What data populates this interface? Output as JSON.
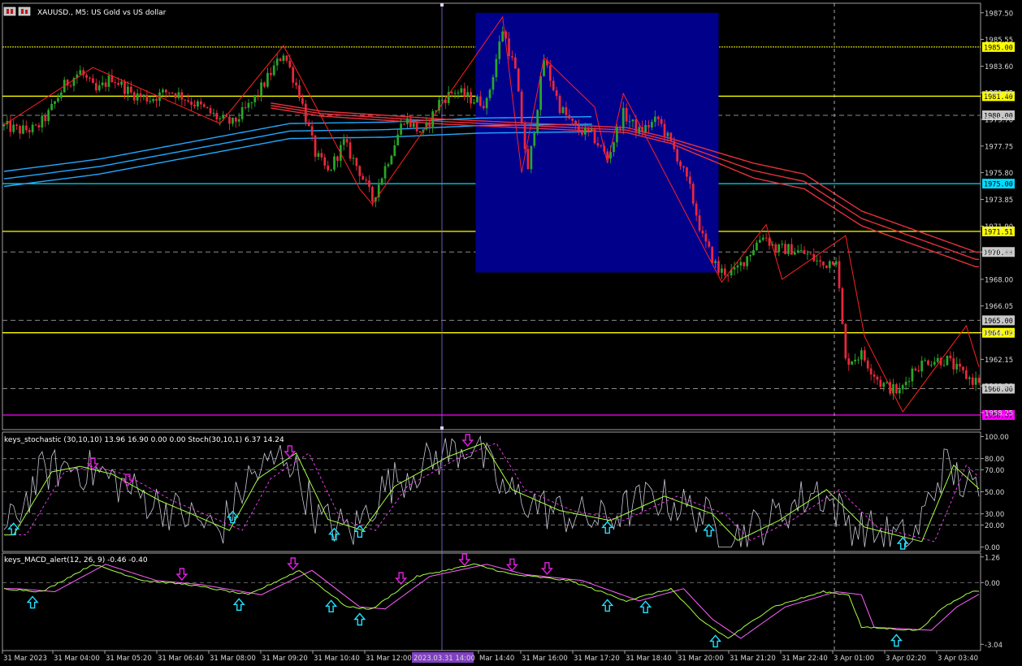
{
  "window": {
    "title": "XAUUSD., M5:  US Gold vs US dollar",
    "icon": "chart-window-icon"
  },
  "colors": {
    "background": "#000000",
    "frame": "#c8c8c8",
    "bull": "#2aa52a",
    "bear": "#e8283c",
    "yellow": "#ffff00",
    "cyan": "#00dcff",
    "magenta": "#ff00ff",
    "dash": "#8a8a8a",
    "rect": "#00008b",
    "ma_red": "#e8303c",
    "ma_blue": "#22a8ff",
    "zigzag": "#ff2020",
    "stoch_main": "#c8c8d8",
    "stoch_signal": "#a8ff40",
    "stoch_dash": "#ff40ff",
    "macd_main": "#a8ff40",
    "macd_signal": "#ff60ff",
    "arrow_up": "#20e0ff",
    "arrow_down": "#e020e0",
    "time_label_bg": "#8040c0"
  },
  "main_panel": {
    "price_axis": [
      "1987.50",
      "1985.55",
      "1983.60",
      "1981.65",
      "1979.70",
      "1977.75",
      "1975.80",
      "1973.85",
      "1971.90",
      "1970.00",
      "1968.00",
      "1966.05",
      "1964.10",
      "1962.15",
      "1960.20",
      "1958.25"
    ],
    "ylim": [
      1957.0,
      1988.2
    ],
    "levels": [
      {
        "price": 1985.0,
        "label": "1985.00",
        "style": "dotted",
        "color": "#ffff00"
      },
      {
        "price": 1981.4,
        "label": "1981.40",
        "style": "solid",
        "color": "#ffff00"
      },
      {
        "price": 1980.0,
        "label": "1980.00",
        "style": "dash",
        "color": "#8a8a8a"
      },
      {
        "price": 1975.0,
        "label": "1975.00",
        "style": "solid",
        "color": "#00dcff"
      },
      {
        "price": 1971.51,
        "label": "1971.51",
        "style": "solid",
        "color": "#ffff00"
      },
      {
        "price": 1970.0,
        "label": "1970.00",
        "style": "dash",
        "color": "#8a8a8a"
      },
      {
        "price": 1965.0,
        "label": "1965.00",
        "style": "dash",
        "color": "#8a8a8a"
      },
      {
        "price": 1964.09,
        "label": "1964.09",
        "style": "solid",
        "color": "#ffff00"
      },
      {
        "price": 1960.0,
        "label": "1960.00",
        "style": "dash",
        "color": "#8a8a8a"
      },
      {
        "price": 1958.07,
        "label": "1958.07",
        "style": "solid",
        "color": "#ff00ff"
      }
    ],
    "zone": {
      "from_time": "31 Mar 14:00",
      "to_time": "31 Mar 20:40",
      "price_top": 1987.5,
      "price_bottom": 1968.5
    }
  },
  "stoch_panel": {
    "title": "keys_stochastic (30,10,10) 13.96 16.90 0.00 0.00 Stoch(30,10,1) 6.37 14.24",
    "axis": [
      "100.00",
      "80.00",
      "70.00",
      "50.00",
      "30.00",
      "20.00",
      "0.00"
    ],
    "ylim": [
      -4,
      104
    ],
    "levels": [
      80,
      70,
      50,
      30,
      20
    ]
  },
  "macd_panel": {
    "title": "keys_MACD_alert(12, 26, 9) -0.46 -0.40",
    "axis": [
      "1.26",
      "0.00",
      "-3.04"
    ],
    "ylim": [
      -3.35,
      1.45
    ]
  },
  "time_axis": {
    "labels": [
      "31 Mar 2023",
      "31 Mar 04:00",
      "31 Mar 05:20",
      "31 Mar 06:40",
      "31 Mar 08:00",
      "31 Mar 09:20",
      "31 Mar 10:40",
      "31 Mar 12:00",
      "Mar 14:40",
      "31 Mar 16:00",
      "31 Mar 17:20",
      "31 Mar 18:40",
      "31 Mar 20:00",
      "31 Mar 21:20",
      "31 Mar 22:40",
      "3 Apr 01:00",
      "3 Apr 02:20",
      "3 Apr 03:40"
    ],
    "cursor_label": "2023.03.31 14:00"
  },
  "chart_data": {
    "type": "candlestick",
    "title": "XAUUSD., M5:  US Gold vs US dollar",
    "anchors": [
      [
        0,
        1979.2
      ],
      [
        5,
        1978.9
      ],
      [
        10,
        1979.0
      ],
      [
        14,
        1980.1
      ],
      [
        19,
        1982.2
      ],
      [
        24,
        1983.2
      ],
      [
        29,
        1981.7
      ],
      [
        34,
        1982.8
      ],
      [
        40,
        1981.6
      ],
      [
        46,
        1981.2
      ],
      [
        52,
        1981.8
      ],
      [
        56,
        1981.4
      ],
      [
        62,
        1980.6
      ],
      [
        68,
        1979.7
      ],
      [
        72,
        1979.4
      ],
      [
        78,
        1980.9
      ],
      [
        84,
        1983.1
      ],
      [
        88,
        1984.6
      ],
      [
        93,
        1981.6
      ],
      [
        98,
        1977.2
      ],
      [
        102,
        1975.8
      ],
      [
        107,
        1978.0
      ],
      [
        112,
        1975.9
      ],
      [
        116,
        1973.8
      ],
      [
        121,
        1976.8
      ],
      [
        126,
        1979.8
      ],
      [
        132,
        1978.6
      ],
      [
        137,
        1981.0
      ],
      [
        142,
        1981.8
      ],
      [
        147,
        1981.2
      ],
      [
        152,
        1980.9
      ],
      [
        157,
        1986.3
      ],
      [
        161,
        1983.2
      ],
      [
        165,
        1975.8
      ],
      [
        170,
        1984.1
      ],
      [
        175,
        1980.6
      ],
      [
        180,
        1979.0
      ],
      [
        185,
        1978.6
      ],
      [
        190,
        1976.9
      ],
      [
        195,
        1980.1
      ],
      [
        200,
        1978.8
      ],
      [
        206,
        1979.7
      ],
      [
        212,
        1977.0
      ],
      [
        216,
        1974.6
      ],
      [
        220,
        1971.0
      ],
      [
        225,
        1968.6
      ],
      [
        230,
        1968.5
      ],
      [
        234,
        1969.7
      ],
      [
        239,
        1971.3
      ],
      [
        243,
        1970.2
      ],
      [
        248,
        1970.2
      ],
      [
        253,
        1969.8
      ],
      [
        258,
        1969.0
      ],
      [
        262,
        1969.7
      ],
      [
        265,
        1962.0
      ],
      [
        270,
        1962.5
      ],
      [
        276,
        1960.4
      ],
      [
        282,
        1959.7
      ],
      [
        286,
        1961.4
      ],
      [
        291,
        1962.1
      ],
      [
        297,
        1962.1
      ],
      [
        300,
        1961.4
      ],
      [
        305,
        1960.6
      ]
    ],
    "stoch_anchors": [
      [
        0,
        11
      ],
      [
        12,
        68
      ],
      [
        21,
        73
      ],
      [
        31,
        66
      ],
      [
        46,
        42
      ],
      [
        56,
        30
      ],
      [
        68,
        15
      ],
      [
        77,
        62
      ],
      [
        89,
        85
      ],
      [
        99,
        25
      ],
      [
        110,
        15
      ],
      [
        120,
        55
      ],
      [
        137,
        82
      ],
      [
        148,
        94
      ],
      [
        157,
        52
      ],
      [
        172,
        33
      ],
      [
        188,
        24
      ],
      [
        205,
        46
      ],
      [
        220,
        30
      ],
      [
        228,
        6
      ],
      [
        241,
        24
      ],
      [
        256,
        52
      ],
      [
        268,
        18
      ],
      [
        286,
        5
      ],
      [
        296,
        74
      ],
      [
        305,
        50
      ]
    ],
    "macd_anchors": [
      [
        0,
        -0.3
      ],
      [
        12,
        -0.45
      ],
      [
        28,
        0.9
      ],
      [
        44,
        0.1
      ],
      [
        58,
        -0.1
      ],
      [
        77,
        -0.6
      ],
      [
        93,
        0.6
      ],
      [
        108,
        -1.2
      ],
      [
        116,
        -1.3
      ],
      [
        130,
        0.3
      ],
      [
        148,
        0.9
      ],
      [
        160,
        0.4
      ],
      [
        178,
        0.1
      ],
      [
        196,
        -0.9
      ],
      [
        210,
        -0.3
      ],
      [
        219,
        -1.8
      ],
      [
        228,
        -2.75
      ],
      [
        242,
        -1.2
      ],
      [
        258,
        -0.45
      ],
      [
        266,
        -0.6
      ],
      [
        270,
        -2.2
      ],
      [
        288,
        -2.35
      ],
      [
        296,
        -1.2
      ],
      [
        305,
        -0.4
      ]
    ],
    "zigzag_price": [
      [
        0,
        1979.3
      ],
      [
        28,
        1983.5
      ],
      [
        68,
        1979.4
      ],
      [
        88,
        1985.1
      ],
      [
        112,
        1974.6
      ],
      [
        116,
        1973.5
      ],
      [
        157,
        1987.2
      ],
      [
        163,
        1975.8
      ],
      [
        170,
        1984.2
      ],
      [
        186,
        1980.6
      ],
      [
        190,
        1976.5
      ],
      [
        195,
        1981.6
      ],
      [
        226,
        1967.8
      ],
      [
        240,
        1972.0
      ],
      [
        245,
        1968.0
      ],
      [
        265,
        1971.2
      ],
      [
        271,
        1963.8
      ],
      [
        283,
        1958.3
      ],
      [
        303,
        1964.6
      ],
      [
        307,
        1961.6
      ]
    ],
    "ma_red": {
      "from": 84,
      "anchors": [
        [
          84,
          1980.9
        ],
        [
          100,
          1980.3
        ],
        [
          140,
          1979.7
        ],
        [
          196,
          1979.1
        ],
        [
          210,
          1978.3
        ],
        [
          236,
          1976.5
        ],
        [
          252,
          1975.7
        ],
        [
          270,
          1973.0
        ],
        [
          306,
          1970.0
        ]
      ]
    },
    "ma_blue": {
      "to": 185,
      "anchors": [
        [
          0,
          1975.9
        ],
        [
          30,
          1976.8
        ],
        [
          60,
          1978.1
        ],
        [
          90,
          1979.4
        ],
        [
          120,
          1979.5
        ],
        [
          150,
          1979.8
        ],
        [
          185,
          1979.9
        ]
      ]
    },
    "stoch_signals": [
      {
        "bar": 3,
        "dir": "up"
      },
      {
        "bar": 28,
        "dir": "down"
      },
      {
        "bar": 39,
        "dir": "down"
      },
      {
        "bar": 72,
        "dir": "up"
      },
      {
        "bar": 90,
        "dir": "down"
      },
      {
        "bar": 104,
        "dir": "up"
      },
      {
        "bar": 112,
        "dir": "up"
      },
      {
        "bar": 146,
        "dir": "down"
      },
      {
        "bar": 190,
        "dir": "up"
      },
      {
        "bar": 222,
        "dir": "up"
      },
      {
        "bar": 283,
        "dir": "up"
      }
    ],
    "macd_signals": [
      {
        "bar": 9,
        "dir": "up"
      },
      {
        "bar": 56,
        "dir": "down"
      },
      {
        "bar": 74,
        "dir": "up"
      },
      {
        "bar": 91,
        "dir": "down"
      },
      {
        "bar": 103,
        "dir": "up"
      },
      {
        "bar": 112,
        "dir": "up"
      },
      {
        "bar": 125,
        "dir": "down"
      },
      {
        "bar": 145,
        "dir": "down"
      },
      {
        "bar": 160,
        "dir": "down"
      },
      {
        "bar": 171,
        "dir": "down"
      },
      {
        "bar": 190,
        "dir": "up"
      },
      {
        "bar": 202,
        "dir": "up"
      },
      {
        "bar": 224,
        "dir": "up"
      },
      {
        "bar": 281,
        "dir": "up"
      }
    ],
    "bars": 308
  }
}
